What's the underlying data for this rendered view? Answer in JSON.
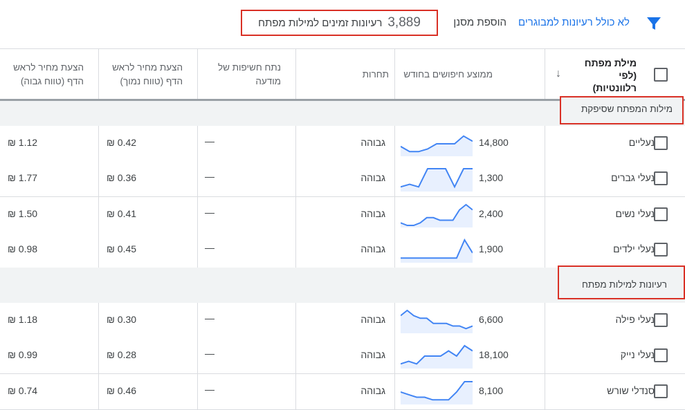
{
  "toolbar": {
    "adult_link": "לא כולל רעיונות למבוגרים",
    "add_filter": "הוספת מסנן",
    "ideas_count": "3,889",
    "ideas_label": "רעיונות זמינים למילות מפתח",
    "accent_color": "#1a73e8",
    "highlight_color": "#d93025",
    "filter_icon": "filter-icon"
  },
  "columns": {
    "keyword": "מילת מפתח (לפי רלוונטיות)",
    "avg_searches": "ממוצע חיפושים בחודש",
    "competition": "תחרות",
    "impression_share": "נתח חשיפות של מודעה",
    "bid_low": "הצעת מחיר לראש הדף (טווח נמוך)",
    "bid_high": "הצעת מחיר לראש הדף (טווח גבוה)",
    "sort_icon": "arrow-down-icon"
  },
  "sections": {
    "provided": "מילות המפתח שסיפקת",
    "ideas": "רעיונות למילות מפתח"
  },
  "rows_provided": [
    {
      "keyword": "נעליים",
      "volume": "14,800",
      "competition": "גבוהה",
      "share": "—",
      "bid_low": "₪ 0.42",
      "bid_high": "₪ 1.12"
    },
    {
      "keyword": "נעלי גברים",
      "volume": "1,300",
      "competition": "גבוהה",
      "share": "—",
      "bid_low": "₪ 0.36",
      "bid_high": "₪ 1.77"
    },
    {
      "keyword": "נעלי נשים",
      "volume": "2,400",
      "competition": "גבוהה",
      "share": "—",
      "bid_low": "₪ 0.41",
      "bid_high": "₪ 1.50"
    },
    {
      "keyword": "נעלי ילדים",
      "volume": "1,900",
      "competition": "גבוהה",
      "share": "—",
      "bid_low": "₪ 0.45",
      "bid_high": "₪ 0.98"
    }
  ],
  "rows_ideas": [
    {
      "keyword": "נעלי פילה",
      "volume": "6,600",
      "competition": "גבוהה",
      "share": "—",
      "bid_low": "₪ 0.30",
      "bid_high": "₪ 1.18"
    },
    {
      "keyword": "נעלי נייק",
      "volume": "18,100",
      "competition": "גבוהה",
      "share": "—",
      "bid_low": "₪ 0.28",
      "bid_high": "₪ 0.99"
    },
    {
      "keyword": "סנדלי שורש",
      "volume": "8,100",
      "competition": "גבוהה",
      "share": "—",
      "bid_low": "₪ 0.46",
      "bid_high": "₪ 0.74"
    }
  ],
  "trends": {
    "line_color": "#4285f4",
    "fill_color": "#e8f0fe",
    "provided": [
      [
        3,
        1,
        1,
        2,
        4,
        4,
        4,
        7,
        5
      ],
      [
        1,
        2,
        1,
        8,
        8,
        8,
        1,
        8,
        8
      ],
      [
        1,
        0,
        0,
        1,
        3,
        3,
        2,
        2,
        2,
        6,
        8,
        6
      ],
      [
        1,
        1,
        1,
        1,
        1,
        1,
        1,
        1,
        8,
        3
      ]
    ],
    "ideas": [
      [
        6,
        8,
        6,
        5,
        5,
        3,
        3,
        3,
        2,
        2,
        1,
        2
      ],
      [
        1,
        2,
        1,
        4,
        4,
        4,
        6,
        4,
        8,
        6
      ],
      [
        4,
        3,
        2,
        2,
        1,
        1,
        1,
        4,
        8,
        8
      ]
    ]
  }
}
